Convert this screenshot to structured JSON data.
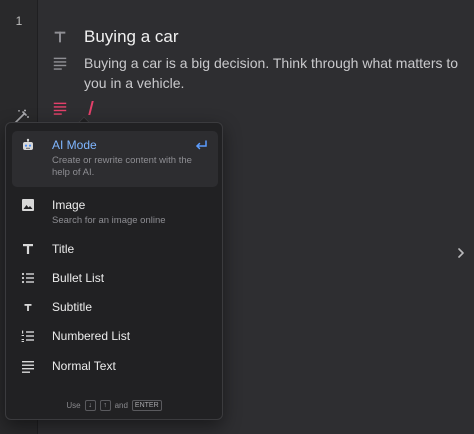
{
  "editor": {
    "page_number": "1",
    "blocks": [
      {
        "type": "title",
        "text": "Buying a car",
        "icon": "title-icon"
      },
      {
        "type": "paragraph",
        "text": "Buying a car is a big decision. Think through what matters to you in a vehicle.",
        "icon": "paragraph-icon"
      }
    ],
    "current_block_icon": "paragraph-icon",
    "accent_color": "#e4406a"
  },
  "menu": {
    "items": [
      {
        "label": "AI Mode",
        "description": "Create or rewrite content with the help of AI.",
        "icon": "robot-icon",
        "active": true
      },
      {
        "label": "Image",
        "description": "Search for an image online",
        "icon": "image-icon"
      },
      {
        "label": "Title",
        "description": "",
        "icon": "title-icon"
      },
      {
        "label": "Bullet List",
        "description": "",
        "icon": "bullet-list-icon"
      },
      {
        "label": "Subtitle",
        "description": "",
        "icon": "subtitle-icon"
      },
      {
        "label": "Numbered List",
        "description": "",
        "icon": "numbered-list-icon"
      },
      {
        "label": "Normal Text",
        "description": "",
        "icon": "paragraph-icon"
      }
    ],
    "hint": {
      "use": "Use",
      "up": "↓",
      "down": "↑",
      "and": "and",
      "enter": "ENTER"
    },
    "active_color": "#7fb6ff"
  }
}
